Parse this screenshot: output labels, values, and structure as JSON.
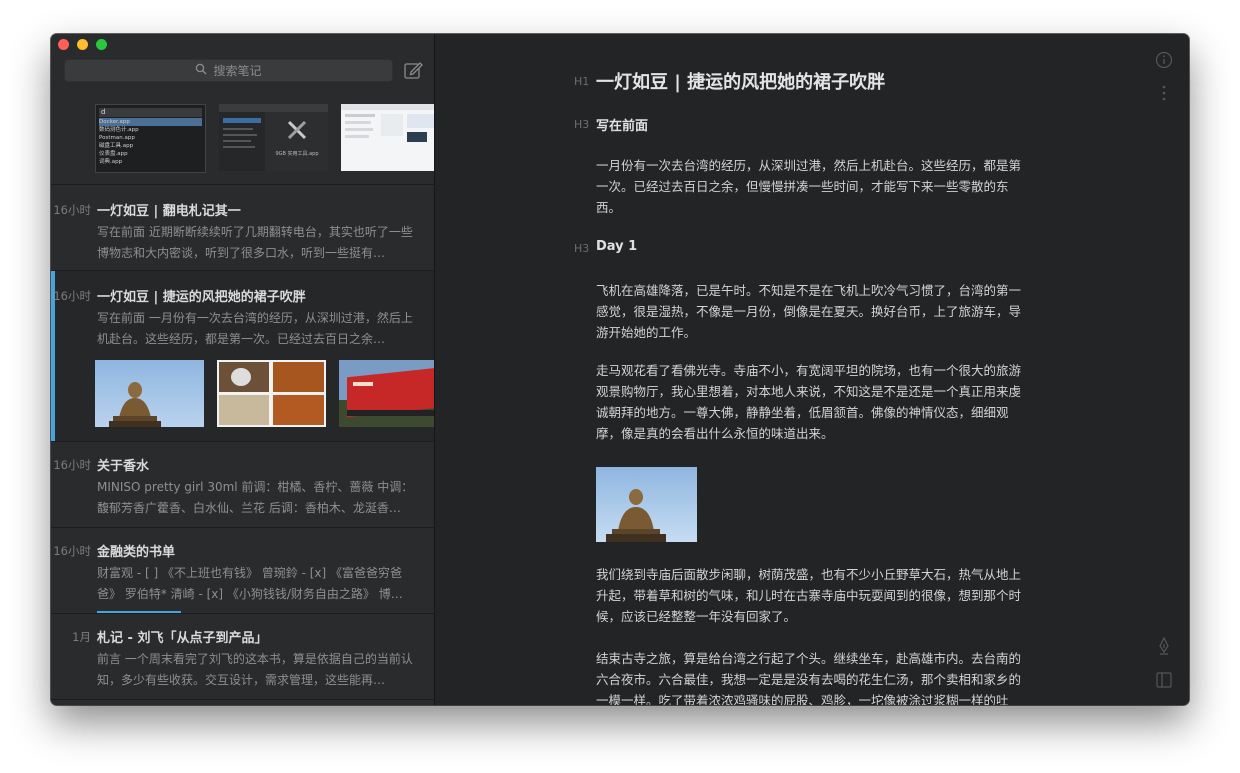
{
  "search": {
    "placeholder": "搜索笔记"
  },
  "notes": [
    {
      "time": "16小时",
      "title": "一灯如豆 | 翻电札记其一",
      "excerpt": "写在前面 近期断断续续听了几期翻转电台，其实也听了一些博物志和大内密谈，听到了很多口水，听到一些挺有…"
    },
    {
      "time": "16小时",
      "title": "一灯如豆 | 捷运的风把她的裙子吹胖",
      "excerpt": "写在前面 一月份有一次去台湾的经历，从深圳过港，然后上机赴台。这些经历，都是第一次。已经过去百日之余…"
    },
    {
      "time": "16小时",
      "title": "关于香水",
      "excerpt": "MINISO pretty girl 30ml 前调：柑橘、香柠、蔷薇 中调：馥郁芳香广藿香、白水仙、兰花 后调：香柏木、龙涎香…"
    },
    {
      "time": "16小时",
      "title": "金融类的书单",
      "excerpt": "财富观 - [ ] 《不上班也有钱》 曾琬鈴 - [x] 《富爸爸穷爸爸》 罗伯特* 清崎 - [x] 《小狗钱钱/财务自由之路》 博…",
      "progress": 0.3
    },
    {
      "time": "1月",
      "title": "札记 - 刘飞「从点子到产品」",
      "excerpt": "前言 一个周末看完了刘飞的这本书，算是依据自己的当前认知，多少有些收获。交互设计，需求管理，这些能再…"
    }
  ],
  "top_thumbs": {
    "input_char": "d",
    "apps": [
      "Docker.app",
      "数码测色计.app",
      "Postman.app",
      "磁盘工具.app",
      "仪表盘.app",
      "词典.app"
    ],
    "util_caption": "9GB 实用工具.app"
  },
  "editor": {
    "h1_mark": "H1",
    "h3_mark": "H3",
    "title": "一灯如豆 | 捷运的风把她的裙子吹胖",
    "section1": "写在前面",
    "p1": "一月份有一次去台湾的经历，从深圳过港，然后上机赴台。这些经历，都是第一次。已经过去百日之余，但慢慢拼凑一些时间，才能写下来一些零散的东西。",
    "section2": "Day 1",
    "p2": "飞机在高雄降落，已是午时。不知是不是在飞机上吹冷气习惯了，台湾的第一感觉，很是湿热，不像是一月份，倒像是在夏天。换好台币，上了旅游车，导游开始她的工作。",
    "p3": "走马观花看了看佛光寺。寺庙不小，有宽阔平坦的院场，也有一个很大的旅游观景购物厅，我心里想着，对本地人来说，不知这是不是还是一个真正用来虔诚朝拜的地方。一尊大佛，静静坐着，低眉颔首。佛像的神情仪态，细细观摩，像是真的会看出什么永恒的味道出来。",
    "p4": "我们绕到寺庙后面散步闲聊，树荫茂盛，也有不少小丘野草大石，热气从地上升起，带着草和树的气味，和儿时在古寨寺庙中玩耍闻到的很像，想到那个时候，应该已经整整一年没有回家了。",
    "p5": "结束古寺之旅，算是给台湾之行起了个头。继续坐车，赴高雄市内。去台南的六合夜市。六合最佳，我想一定是是没有去喝的花生仁汤，那个卖相和家乡的一模一样。吃了带着浓浓鸡骚味的屁股、鸡胗，一坨像被涂过浆糊一样的吐"
  },
  "colors": {
    "accent": "#4aa3df",
    "window_bg": "#222325",
    "list_bg": "#2a2b2d"
  }
}
